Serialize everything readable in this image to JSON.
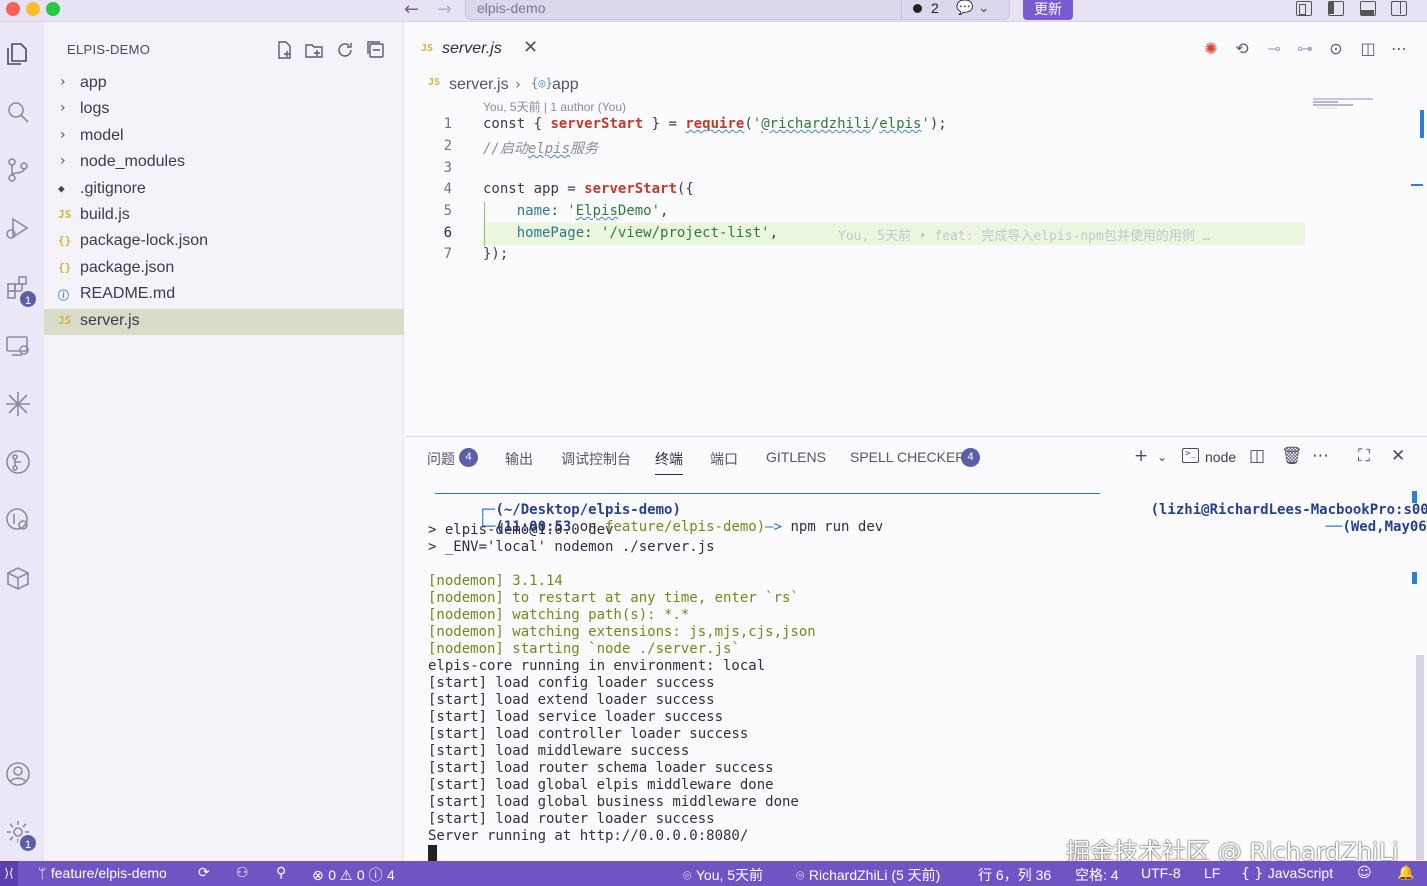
{
  "window": {
    "title": "elpis-demo",
    "dirty_count": "2",
    "update_label": "更新"
  },
  "activity_bar": {
    "extensions_badge": "1",
    "settings_badge": "1"
  },
  "sidebar": {
    "title": "ELPIS-DEMO",
    "items": [
      {
        "label": "app",
        "type": "folder"
      },
      {
        "label": "logs",
        "type": "folder"
      },
      {
        "label": "model",
        "type": "folder"
      },
      {
        "label": "node_modules",
        "type": "folder"
      },
      {
        "label": ".gitignore",
        "type": "git",
        "icon": "◆"
      },
      {
        "label": "build.js",
        "type": "js",
        "icon": "JS"
      },
      {
        "label": "package-lock.json",
        "type": "json",
        "icon": "{}"
      },
      {
        "label": "package.json",
        "type": "json",
        "icon": "{}"
      },
      {
        "label": "README.md",
        "type": "info",
        "icon": "ⓘ"
      },
      {
        "label": "server.js",
        "type": "js",
        "icon": "JS",
        "selected": true
      }
    ]
  },
  "editor": {
    "tab": {
      "icon": "JS",
      "label": "server.js"
    },
    "breadcrumb": {
      "icon": "JS",
      "file": "server.js",
      "symbol_icon": "{◎}",
      "symbol": "app"
    },
    "blame_header": "You, 5天前 | 1 author (You)",
    "inline_blame": "You, 5天前 • feat: 完成导入elpis-npm包并使用的用例 …",
    "line_numbers": [
      "1",
      "2",
      "3",
      "4",
      "5",
      "6",
      "7"
    ]
  },
  "panel": {
    "tabs": {
      "problems": "问题",
      "problems_badge": "4",
      "output": "输出",
      "debug_console": "调试控制台",
      "terminal": "终端",
      "ports": "端口",
      "gitlens": "GITLENS",
      "spell_checker": "SPELL CHECKER",
      "spell_badge": "4"
    },
    "terminal_name": "node",
    "prompt": {
      "path": "(~/Desktop/elpis-demo)",
      "user": "(lizhi@RichardLees-MacbookPro:s004)",
      "time": "(11:00:53",
      "on": " on ",
      "branch": "feature/elpis-demo)",
      "arrow": "—> ",
      "command": "npm run dev",
      "date": "(Wed,May06)"
    },
    "lines": [
      "> elpis-demo@1.0.0 dev",
      "> _ENV='local' nodemon ./server.js",
      "",
      "[nodemon] 3.1.14",
      "[nodemon] to restart at any time, enter `rs`",
      "[nodemon] watching path(s): *.*",
      "[nodemon] watching extensions: js,mjs,cjs,json",
      "[nodemon] starting `node ./server.js`",
      "elpis-core running in environment: local",
      "[start] load config loader success",
      "[start] load extend loader success",
      "[start] load service loader success",
      "[start] load controller loader success",
      "[start] load middleware success",
      "[start] load router schema loader success",
      "[start] load global elpis middleware done",
      "[start] load global business middleware done",
      "[start] load router loader success",
      "Server running at http://0.0.0.0:8080/"
    ]
  },
  "watermark": "掘金技术社区 @ RichardZhiLi",
  "statusbar": {
    "branch": "feature/elpis-demo",
    "errors": "0",
    "warnings": "0",
    "infos": "4",
    "blame": "You, 5天前",
    "author": "RichardZhiLi (5 天前)",
    "position": "行 6，列 36",
    "spaces": "空格: 4",
    "encoding": "UTF-8",
    "eol": "LF",
    "language": "JavaScript"
  }
}
